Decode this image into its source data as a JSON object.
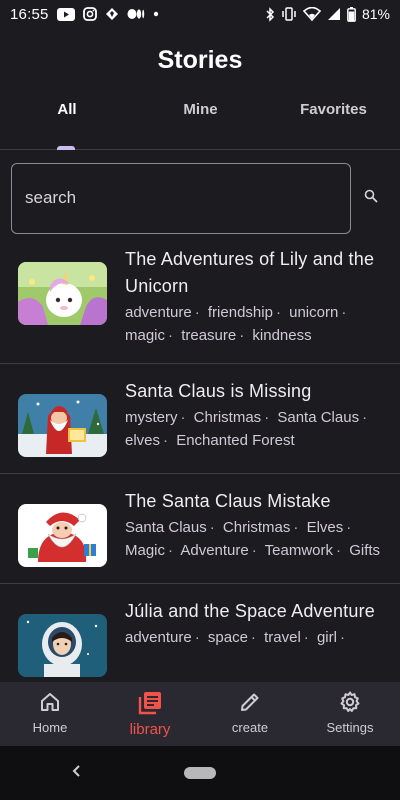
{
  "status_bar": {
    "time": "16:55",
    "battery": "81%",
    "left_icons": [
      "youtube-icon",
      "instagram-icon",
      "notification-icon",
      "medium-icon",
      "dot-icon"
    ],
    "right_icons": [
      "bluetooth-icon",
      "vibrate-icon",
      "wifi-icon",
      "signal-icon",
      "battery-icon"
    ]
  },
  "header": {
    "title": "Stories"
  },
  "tabs": [
    {
      "label": "All",
      "active": true
    },
    {
      "label": "Mine",
      "active": false
    },
    {
      "label": "Favorites",
      "active": false
    }
  ],
  "search": {
    "placeholder": "search",
    "value": ""
  },
  "stories": [
    {
      "title": "The Adventures of Lily and the Unicorn",
      "tags": [
        "adventure",
        "friendship",
        "unicorn",
        "magic",
        "treasure",
        "kindness"
      ],
      "thumbnail": "unicorn-illustration"
    },
    {
      "title": "Santa Claus is Missing",
      "tags": [
        "mystery",
        "Christmas",
        "Santa Claus",
        "elves",
        "Enchanted Forest"
      ],
      "thumbnail": "santa-reading-illustration"
    },
    {
      "title": "The Santa Claus Mistake",
      "tags": [
        "Santa Claus",
        "Christmas",
        "Elves",
        "Magic",
        "Adventure",
        "Teamwork",
        "Gifts"
      ],
      "thumbnail": "santa-cartoon-illustration"
    },
    {
      "title": "Júlia and the Space Adventure",
      "tags": [
        "adventure",
        "space",
        "travel",
        "girl"
      ],
      "thumbnail": "astronaut-girl-illustration"
    }
  ],
  "bottom_nav": [
    {
      "label": "Home",
      "icon": "home-icon",
      "active": false
    },
    {
      "label": "library",
      "icon": "library-icon",
      "active": true
    },
    {
      "label": "create",
      "icon": "pencil-icon",
      "active": false
    },
    {
      "label": "Settings",
      "icon": "gear-icon",
      "active": false
    }
  ],
  "colors": {
    "background": "#1c1b1f",
    "active_nav": "#f2524a",
    "tab_indicator": "#cbbcf2",
    "nav_background": "#2a2830"
  }
}
